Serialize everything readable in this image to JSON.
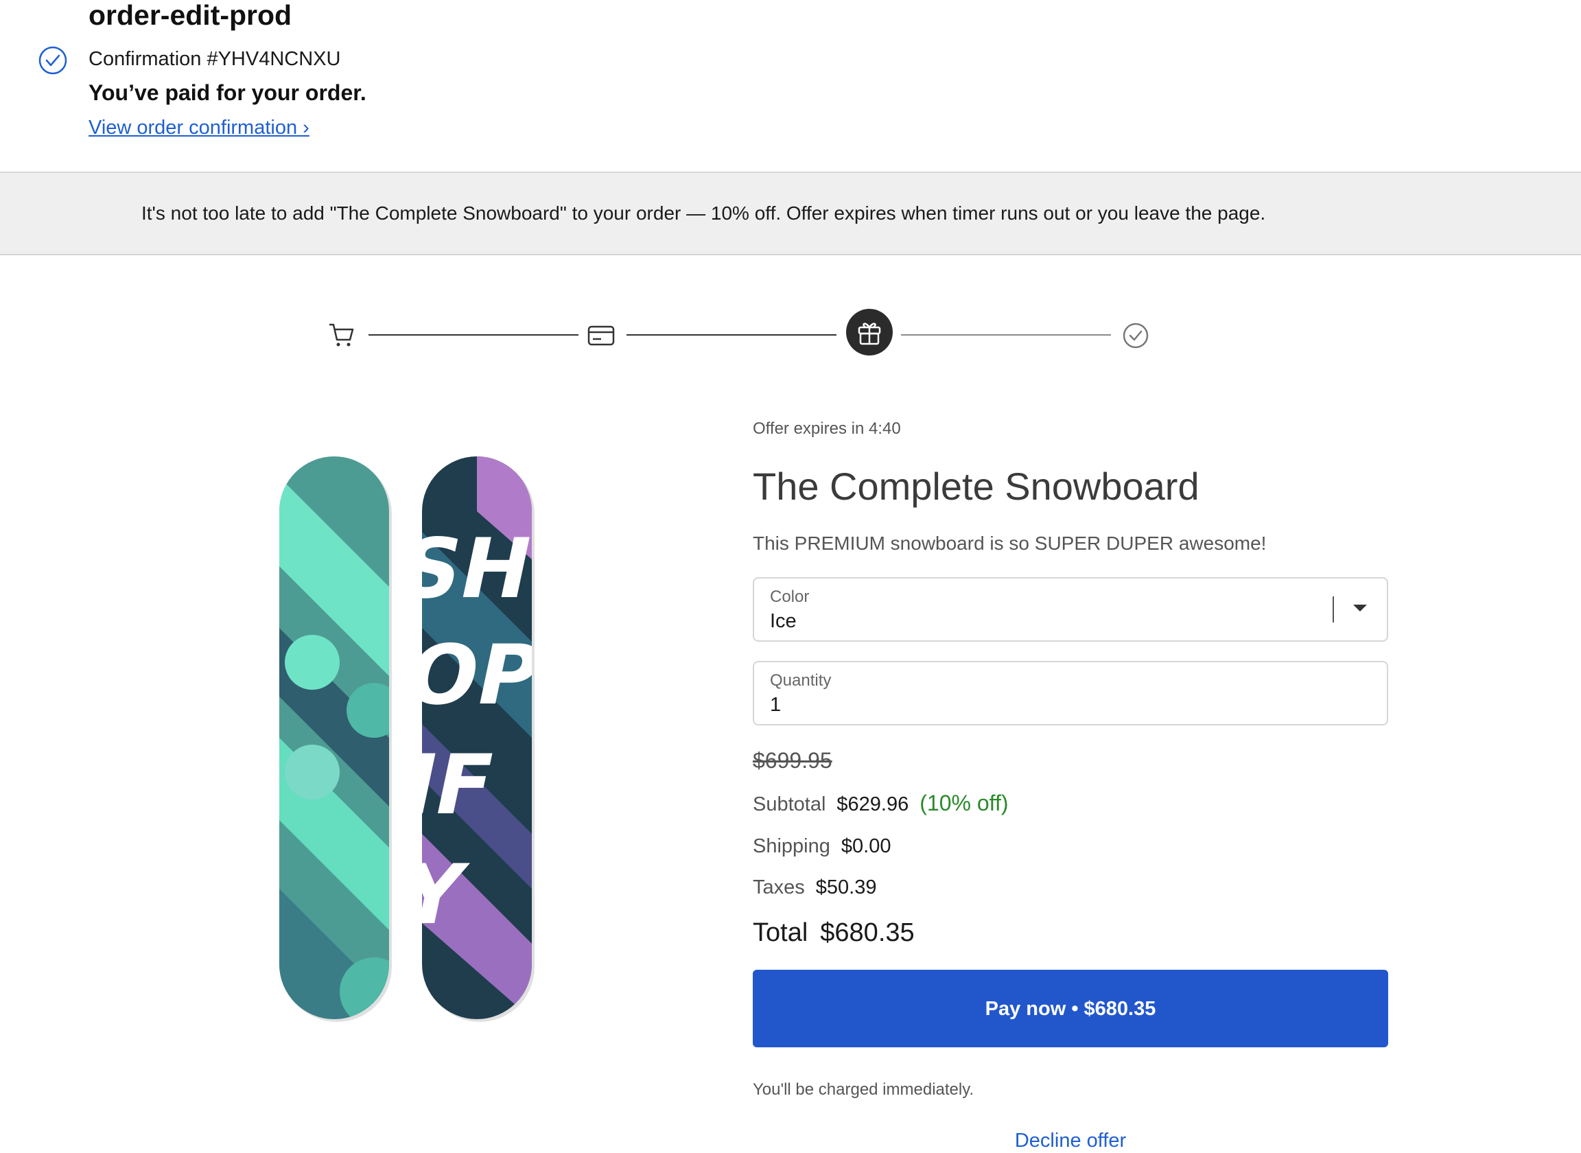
{
  "header": {
    "store_name": "order-edit-prod",
    "confirmation": "Confirmation #YHV4NCNXU",
    "paid_message": "You’ve paid for your order.",
    "view_link": "View order confirmation ›"
  },
  "banner": {
    "text": "It's not too late to add \"The Complete Snowboard\" to your order — 10% off. Offer expires when timer runs out or you leave the page."
  },
  "stepper": {
    "steps": [
      "cart-icon",
      "card-icon",
      "gift-icon",
      "check-icon"
    ],
    "active_step": 3
  },
  "offer": {
    "expires": "Offer expires in 4:40",
    "title": "The Complete Snowboard",
    "description": "This PREMIUM snowboard is so SUPER DUPER awesome!"
  },
  "form": {
    "color_label": "Color",
    "color_value": "Ice",
    "quantity_label": "Quantity",
    "quantity_value": "1"
  },
  "pricing": {
    "original_price": "$699.95",
    "subtotal_label": "Subtotal",
    "subtotal_value": "$629.96",
    "discount": "(10% off)",
    "shipping_label": "Shipping",
    "shipping_value": "$0.00",
    "taxes_label": "Taxes",
    "taxes_value": "$50.39",
    "total_label": "Total",
    "total_value": "$680.35"
  },
  "actions": {
    "pay_label": "Pay now • $680.35",
    "charged_note": "You'll be charged immediately.",
    "decline_label": "Decline offer"
  },
  "colors": {
    "accent": "#2257cc",
    "link": "#1f5fd1",
    "discount": "#2a8a2a",
    "banner_bg": "#efefef"
  }
}
